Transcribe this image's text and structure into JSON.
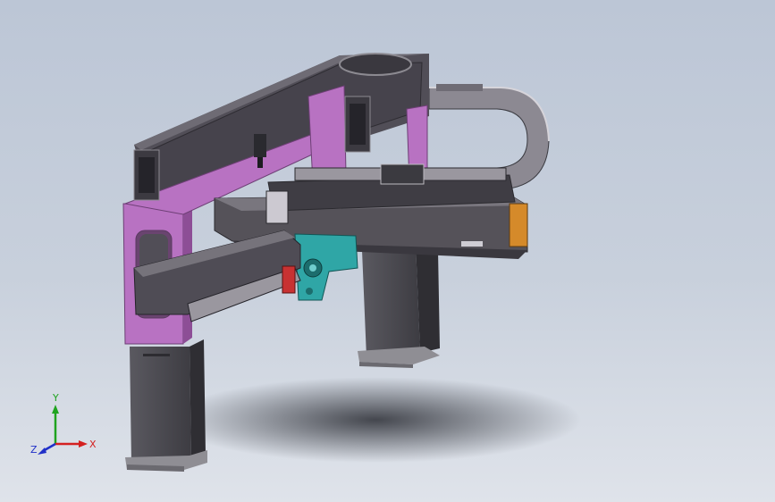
{
  "viewport": {
    "background_top": "#bcc6d6",
    "background_bottom": "#dfe3ea"
  },
  "triad": {
    "x_label": "X",
    "y_label": "Y",
    "z_label": "Z",
    "x_color": "#d42020",
    "y_color": "#1fa31f",
    "z_color": "#2030c8"
  },
  "colors": {
    "bracket": "#b872c2",
    "bracket_dark": "#8d4e96",
    "beam": "#4f4c55",
    "beam_dark": "#3b3940",
    "column": "#4a494f",
    "carriage": "#2fa6a6",
    "cable_chain": "#7d7a82",
    "accent": "#d58a2a",
    "red": "#c83232"
  }
}
